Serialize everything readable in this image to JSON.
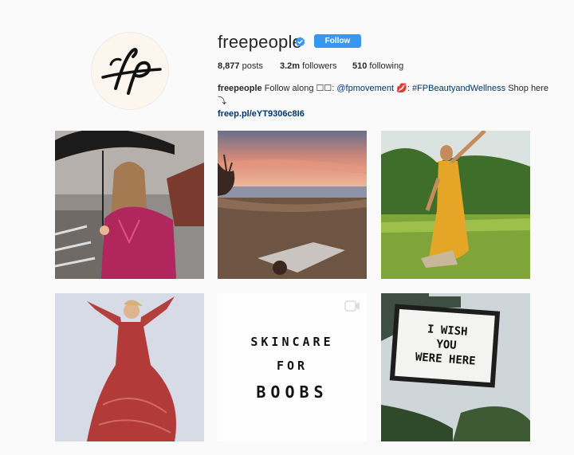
{
  "profile": {
    "username": "freepeople",
    "verified_icon": "verified-badge-icon",
    "follow_label": "Follow",
    "avatar_text": "fp",
    "stats": {
      "posts_count": "8,877",
      "posts_label": "posts",
      "followers_count": "3.2m",
      "followers_label": "followers",
      "following_count": "510",
      "following_label": "following"
    },
    "bio": {
      "name": "freepeople",
      "text1": " Follow along ☐☐: ",
      "mention": "@fpmovement",
      "text2": " 💋: ",
      "hashtag": "#FPBeautyandWellness",
      "text3": " Shop here ⤵",
      "link": "freep.pl/eYT9306c8I6"
    }
  },
  "posts": [
    {
      "id": "post-1",
      "kind": "photo"
    },
    {
      "id": "post-2",
      "kind": "photo"
    },
    {
      "id": "post-3",
      "kind": "photo"
    },
    {
      "id": "post-4",
      "kind": "photo"
    },
    {
      "id": "post-5",
      "kind": "video",
      "lines": [
        "SKINCARE",
        "FOR",
        "BOOBS"
      ]
    },
    {
      "id": "post-6",
      "kind": "photo",
      "sign_lines": [
        "I WISH",
        "YOU",
        "WERE HERE"
      ]
    }
  ],
  "colors": {
    "accent": "#3897f0",
    "link": "#003569",
    "background": "#fafafa"
  }
}
